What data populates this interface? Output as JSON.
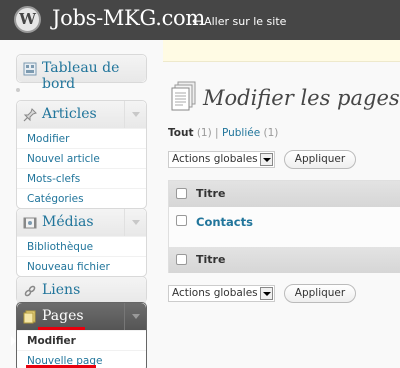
{
  "header": {
    "logo_letter": "W",
    "site_title": "Jobs-MKG.com",
    "visit_site_arrow": "←",
    "visit_site": "Aller sur le site"
  },
  "sidebar": {
    "dashboard": "Tableau de bord",
    "articles": {
      "label": "Articles",
      "items": [
        "Modifier",
        "Nouvel article",
        "Mots-clefs",
        "Catégories"
      ]
    },
    "medias": {
      "label": "Médias",
      "items": [
        "Bibliothèque",
        "Nouveau fichier"
      ]
    },
    "liens": "Liens",
    "pages": {
      "label": "Pages",
      "items": [
        "Modifier",
        "Nouvelle page"
      ]
    }
  },
  "main": {
    "title": "Modifier les pages",
    "filters": {
      "all_label": "Tout",
      "all_count": "(1)",
      "separator": "|",
      "published_label": "Publiée",
      "published_count": "(1)"
    },
    "bulk_actions": {
      "selected": "Actions globales",
      "apply": "Appliquer"
    },
    "table": {
      "header": "Titre",
      "rows": [
        {
          "title": "Contacts"
        }
      ]
    }
  },
  "colors": {
    "header_bg": "#464646",
    "link": "#21759b",
    "active_menu_bg": "#555555",
    "annotation_red": "#e8000d",
    "notice_bg": "#fffbe4"
  },
  "icons": [
    "wordpress-logo-icon",
    "dashboard-icon",
    "pin-icon",
    "media-icon",
    "link-icon",
    "pages-icon",
    "page-stack-icon",
    "dropdown-arrow-icon",
    "collapse-arrow-icon"
  ]
}
